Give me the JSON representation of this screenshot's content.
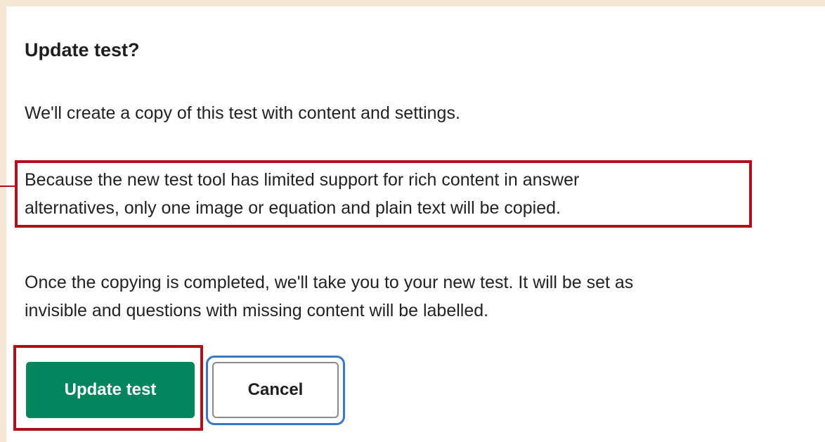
{
  "dialog": {
    "title": "Update test?",
    "paragraphs": [
      {
        "lines": [
          "We'll create a copy of this test with content and settings."
        ]
      },
      {
        "lines": [
          "Because the new test tool has limited support for rich content in answer",
          "alternatives, only one image or equation and plain text will be copied."
        ]
      },
      {
        "lines": [
          "Once the copying is completed, we'll take you to your new test. It will be set as",
          "invisible and questions with missing content will be labelled."
        ]
      }
    ],
    "buttons": {
      "primary_label": "Update test",
      "cancel_label": "Cancel"
    }
  },
  "colors": {
    "page_background": "#f3e6d3",
    "dialog_background": "#ffffff",
    "primary_button": "#00855c",
    "annotation_red": "#b0101a",
    "focus_ring_blue": "#3a78c4"
  }
}
